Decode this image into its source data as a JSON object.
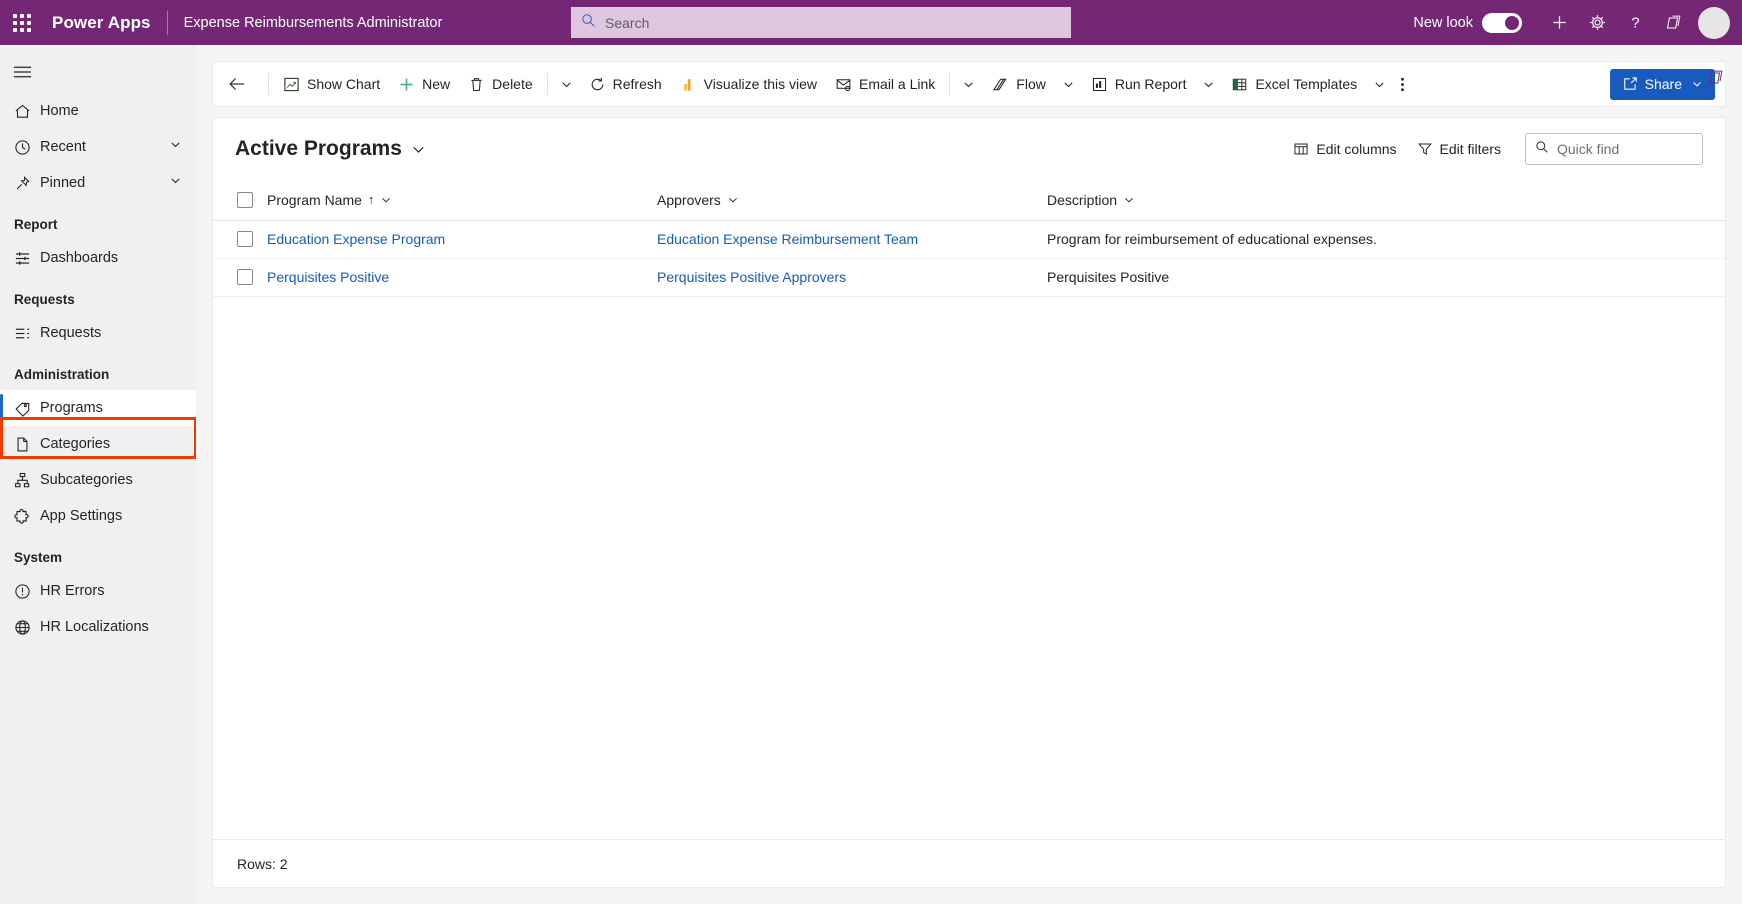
{
  "header": {
    "waffle_label": "app-launcher",
    "brand": "Power Apps",
    "app_name": "Expense Reimbursements Administrator",
    "search_placeholder": "Search",
    "search_value": "",
    "new_look_label": "New look",
    "new_look_on": true,
    "icons": [
      "plus-icon",
      "gear-icon",
      "help-icon",
      "feedback-icon"
    ],
    "colors": {
      "bar": "#742774",
      "search_bg": "#dfc6df"
    }
  },
  "sidebar": {
    "hamburger_label": "site-map-toggle",
    "top_items": [
      {
        "label": "Home",
        "icon": "home-icon",
        "expandable": false
      },
      {
        "label": "Recent",
        "icon": "clock-icon",
        "expandable": true
      },
      {
        "label": "Pinned",
        "icon": "pin-icon",
        "expandable": true
      }
    ],
    "groups": [
      {
        "title": "Report",
        "items": [
          {
            "label": "Dashboards",
            "icon": "dashboard-icon",
            "selected": false
          }
        ]
      },
      {
        "title": "Requests",
        "items": [
          {
            "label": "Requests",
            "icon": "list-icon",
            "selected": false
          }
        ]
      },
      {
        "title": "Administration",
        "items": [
          {
            "label": "Programs",
            "icon": "tag-icon",
            "selected": true
          },
          {
            "label": "Categories",
            "icon": "document-icon",
            "selected": false
          },
          {
            "label": "Subcategories",
            "icon": "hierarchy-icon",
            "selected": false
          },
          {
            "label": "App Settings",
            "icon": "puzzle-icon",
            "selected": false
          }
        ]
      },
      {
        "title": "System",
        "items": [
          {
            "label": "HR Errors",
            "icon": "alert-circle-icon",
            "selected": false
          },
          {
            "label": "HR Localizations",
            "icon": "globe-icon",
            "selected": false
          }
        ]
      }
    ],
    "highlight_color": "#f03b00",
    "selected_accent": "#2266c8"
  },
  "command_bar": {
    "back_label": "back-arrow",
    "items": [
      {
        "label": "Show Chart",
        "icon": "chart-icon"
      },
      {
        "label": "New",
        "icon": "plus-icon"
      },
      {
        "label": "Delete",
        "icon": "trash-icon"
      },
      {
        "label": "Refresh",
        "icon": "refresh-icon"
      },
      {
        "label": "Visualize this view",
        "icon": "insights-icon"
      },
      {
        "label": "Email a Link",
        "icon": "email-icon"
      },
      {
        "label": "Flow",
        "icon": "flow-icon"
      },
      {
        "label": "Run Report",
        "icon": "report-icon"
      },
      {
        "label": "Excel Templates",
        "icon": "excel-icon"
      }
    ],
    "overflow_label": "more-commands",
    "share": {
      "label": "Share",
      "icon": "share-icon",
      "color": "#185abd"
    }
  },
  "view": {
    "title": "Active Programs",
    "edit_columns": "Edit columns",
    "edit_filters": "Edit filters",
    "quick_find_placeholder": "Quick find",
    "quick_find_value": ""
  },
  "table": {
    "columns": [
      {
        "label": "Program Name",
        "sorted": true,
        "sort_dir": "↑"
      },
      {
        "label": "Approvers",
        "sorted": false,
        "sort_dir": ""
      },
      {
        "label": "Description",
        "sorted": false,
        "sort_dir": ""
      }
    ],
    "rows": [
      {
        "name": "Education Expense Program",
        "approvers": "Education Expense Reimbursement Team",
        "description": "Program for reimbursement of educational expenses."
      },
      {
        "name": "Perquisites Positive",
        "approvers": "Perquisites Positive Approvers",
        "description": "Perquisites Positive"
      }
    ],
    "footer": "Rows: 2",
    "link_color": "#185abd"
  }
}
